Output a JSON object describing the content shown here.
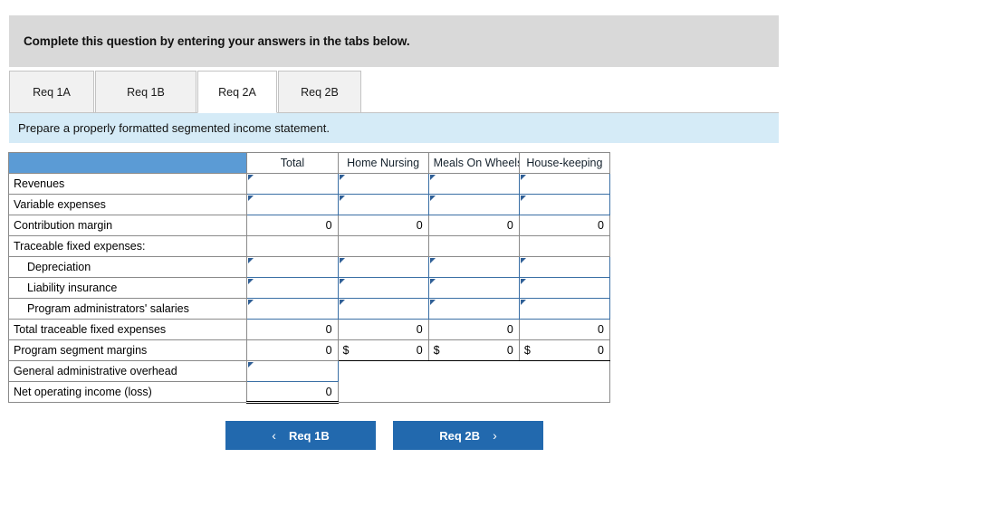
{
  "banner": {
    "instruction": "Complete this question by entering your answers in the tabs below."
  },
  "tabs": [
    {
      "label": "Req 1A",
      "active": false
    },
    {
      "label": "Req 1B",
      "active": false
    },
    {
      "label": "Req 2A",
      "active": true
    },
    {
      "label": "Req 2B",
      "active": false
    }
  ],
  "requirement": {
    "text": "Prepare a properly formatted segmented income statement."
  },
  "table": {
    "headers": [
      "",
      "Total",
      "Home Nursing",
      "Meals On Wheels",
      "House-keeping"
    ],
    "rows": [
      {
        "label": "Revenues",
        "type": "input",
        "values": [
          "",
          "",
          "",
          ""
        ]
      },
      {
        "label": "Variable expenses",
        "type": "input",
        "values": [
          "",
          "",
          "",
          ""
        ]
      },
      {
        "label": "Contribution margin",
        "type": "calc",
        "values": [
          "0",
          "0",
          "0",
          "0"
        ]
      },
      {
        "label": "Traceable fixed expenses:",
        "type": "blank",
        "values": [
          "",
          "",
          "",
          ""
        ]
      },
      {
        "label": "Depreciation",
        "type": "input",
        "indent": true,
        "values": [
          "",
          "",
          "",
          ""
        ]
      },
      {
        "label": "Liability insurance",
        "type": "input",
        "indent": true,
        "values": [
          "",
          "",
          "",
          ""
        ]
      },
      {
        "label": "Program administrators' salaries",
        "type": "input",
        "indent": true,
        "values": [
          "",
          "",
          "",
          ""
        ]
      },
      {
        "label": "Total traceable fixed expenses",
        "type": "total",
        "values": [
          "0",
          "0",
          "0",
          "0"
        ]
      },
      {
        "label": "Program segment margins",
        "type": "money",
        "values": [
          "0",
          "0",
          "0",
          "0"
        ],
        "currency": "$"
      },
      {
        "label": "General administrative overhead",
        "type": "input-single",
        "values": [
          ""
        ]
      },
      {
        "label": "Net operating income (loss)",
        "type": "final",
        "values": [
          "0"
        ]
      }
    ]
  },
  "nav": {
    "prev_label": "Req 1B",
    "next_label": "Req 2B",
    "prev_icon": "chevron-left-icon",
    "next_icon": "chevron-right-icon",
    "prev_chevron": "‹",
    "next_chevron": "›"
  },
  "colors": {
    "header_blue": "#5b9bd5",
    "button_blue": "#2269ae",
    "banner_gray": "#d9d9d9",
    "banner_lightblue": "#d5ebf7",
    "input_border": "#3a6fa5"
  }
}
